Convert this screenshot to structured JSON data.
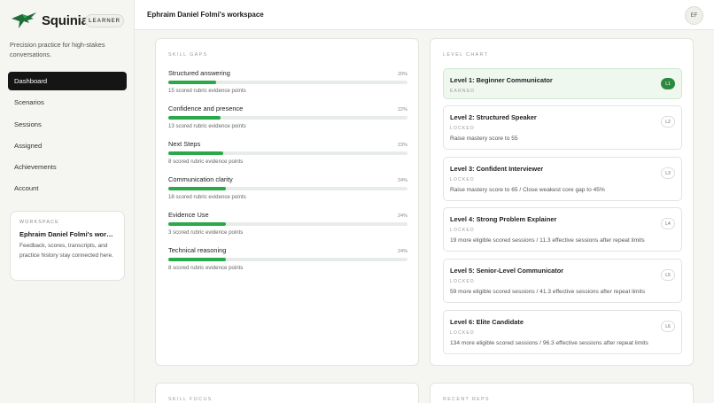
{
  "brand": {
    "name": "Squinia",
    "role": "LEARNER",
    "tagline": "Precision practice for high-stakes conversations.",
    "accent": "#2ba84a"
  },
  "nav": [
    {
      "label": "Dashboard",
      "active": true
    },
    {
      "label": "Scenarios"
    },
    {
      "label": "Sessions"
    },
    {
      "label": "Assigned"
    },
    {
      "label": "Achievements"
    },
    {
      "label": "Account"
    }
  ],
  "workspace_card": {
    "eyebrow": "WORKSPACE",
    "name": "Ephraim Daniel Folmi's works…",
    "desc": "Feedback, scores, transcripts, and practice history stay connected here."
  },
  "header": {
    "title": "Ephraim Daniel Folmi's workspace",
    "avatar": "EF"
  },
  "skill_gaps": {
    "eyebrow": "SKILL GAPS",
    "items": [
      {
        "title": "Structured answering",
        "pct": "20%",
        "value": 0.2,
        "sub": "15 scored rubric evidence points"
      },
      {
        "title": "Confidence and presence",
        "pct": "22%",
        "value": 0.22,
        "sub": "13 scored rubric evidence points"
      },
      {
        "title": "Next Steps",
        "pct": "23%",
        "value": 0.23,
        "sub": "8 scored rubric evidence points"
      },
      {
        "title": "Communication clarity",
        "pct": "24%",
        "value": 0.24,
        "sub": "18 scored rubric evidence points"
      },
      {
        "title": "Evidence Use",
        "pct": "24%",
        "value": 0.24,
        "sub": "3 scored rubric evidence points"
      },
      {
        "title": "Technical reasoning",
        "pct": "24%",
        "value": 0.24,
        "sub": "8 scored rubric evidence points"
      }
    ]
  },
  "level_chart": {
    "eyebrow": "LEVEL CHART",
    "levels": [
      {
        "title": "Level 1: Beginner Communicator",
        "status": "EARNED",
        "desc": "",
        "badge": "L1",
        "earned": true
      },
      {
        "title": "Level 2: Structured Speaker",
        "status": "LOCKED",
        "desc": "Raise mastery score to 55",
        "badge": "L2"
      },
      {
        "title": "Level 3: Confident Interviewer",
        "status": "LOCKED",
        "desc": "Raise mastery score to 65 / Close weakest core gap to 45%",
        "badge": "L3"
      },
      {
        "title": "Level 4: Strong Problem Explainer",
        "status": "LOCKED",
        "desc": "19 more eligible scored sessions / 11.3 effective sessions after repeat limits",
        "badge": "L4"
      },
      {
        "title": "Level 5: Senior-Level Communicator",
        "status": "LOCKED",
        "desc": "59 more eligible scored sessions / 41.3 effective sessions after repeat limits",
        "badge": "L5"
      },
      {
        "title": "Level 6: Elite Candidate",
        "status": "LOCKED",
        "desc": "134 more eligible scored sessions / 96.3 effective sessions after repeat limits",
        "badge": "L6"
      }
    ]
  },
  "skill_focus": {
    "eyebrow": "SKILL FOCUS"
  },
  "recent_reps": {
    "eyebrow": "RECENT REPS"
  }
}
